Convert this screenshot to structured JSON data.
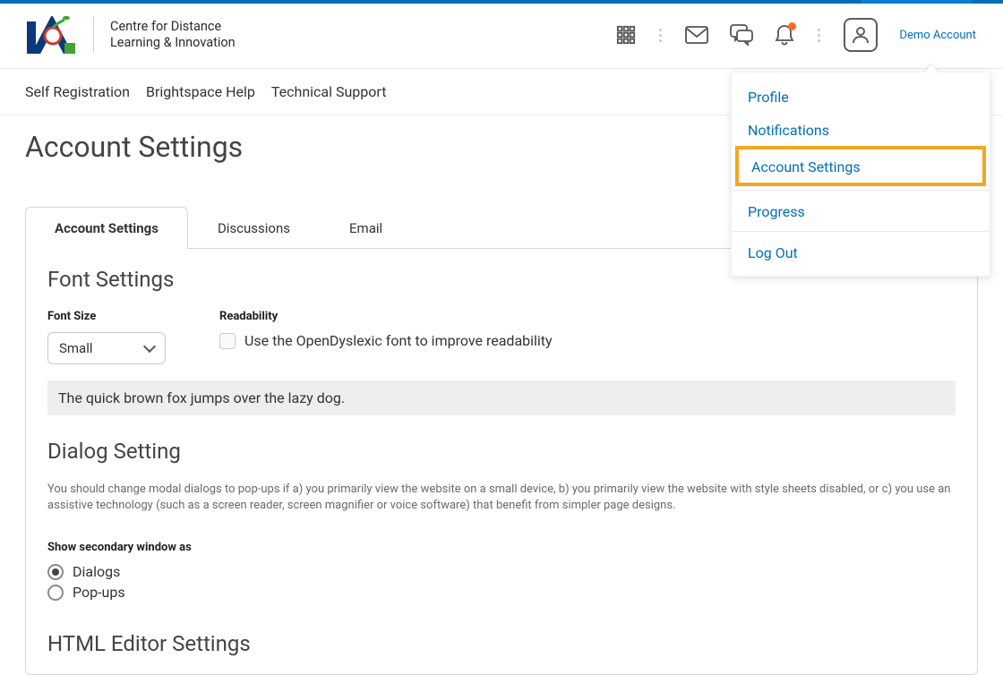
{
  "brand": {
    "name_line1": "Centre for Distance",
    "name_line2": "Learning & Innovation"
  },
  "header": {
    "account_name": "Demo Account"
  },
  "secondary_nav": {
    "items": [
      "Self Registration",
      "Brightspace Help",
      "Technical Support"
    ]
  },
  "user_menu": {
    "items": [
      {
        "label": "Profile",
        "highlighted": false
      },
      {
        "label": "Notifications",
        "highlighted": false
      },
      {
        "label": "Account Settings",
        "highlighted": true
      }
    ],
    "section2": [
      {
        "label": "Progress"
      }
    ],
    "section3": [
      {
        "label": "Log Out"
      }
    ]
  },
  "page": {
    "title": "Account Settings",
    "tabs": [
      {
        "label": "Account Settings",
        "active": true
      },
      {
        "label": "Discussions",
        "active": false
      },
      {
        "label": "Email",
        "active": false
      }
    ]
  },
  "font_settings": {
    "heading": "Font Settings",
    "size_label": "Font Size",
    "size_value": "Small",
    "readability_label": "Readability",
    "readability_option": "Use the OpenDyslexic font to improve readability",
    "preview_text": "The quick brown fox jumps over the lazy dog."
  },
  "dialog_setting": {
    "heading": "Dialog Setting",
    "description": "You should change modal dialogs to pop-ups if a) you primarily view the website on a small device, b) you primarily view the website with style sheets disabled, or c) you use an assistive technology (such as a screen reader, screen magnifier or voice software) that benefit from simpler page designs.",
    "group_label": "Show secondary window as",
    "options": [
      {
        "label": "Dialogs",
        "checked": true
      },
      {
        "label": "Pop-ups",
        "checked": false
      }
    ]
  },
  "html_editor": {
    "heading": "HTML Editor Settings"
  }
}
